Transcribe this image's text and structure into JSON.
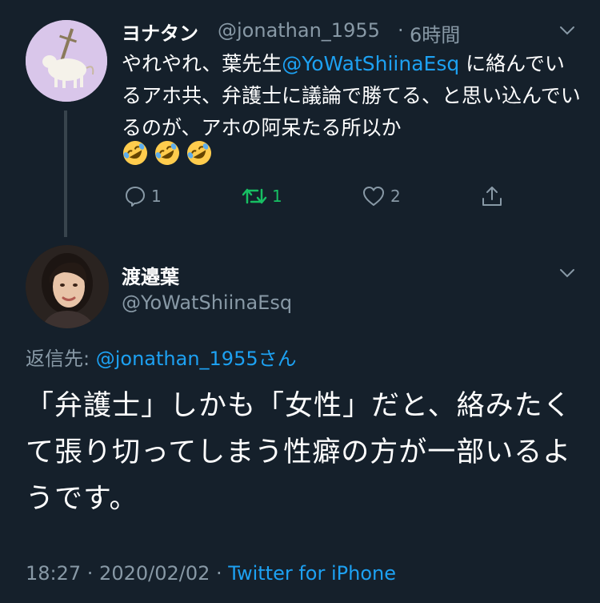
{
  "tweet1": {
    "display_name": "ヨナタン",
    "handle": "@jonathan_1955",
    "separator": "·",
    "time": "6時間",
    "text_prefix": "やれやれ、葉先生",
    "mention": "@YoWatShiinaEsq",
    "text_suffix": " に絡んでいるアホ共、弁護士に議論で勝てる、と思い込んでいるのが、アホの阿呆たる所以か",
    "emojis": [
      "rolling-on-floor-laughing",
      "rolling-on-floor-laughing",
      "rolling-on-floor-laughing"
    ],
    "reply_count": "1",
    "retweet_count": "1",
    "like_count": "2",
    "retweet_color": "#17bf63"
  },
  "tweet2": {
    "display_name": "渡邉葉",
    "handle": "@YoWatShiinaEsq",
    "reply_label": "返信先: ",
    "reply_to": "@jonathan_1955さん",
    "text": "「弁護士」しかも「女性」だと、絡みたくて張り切ってしまう性癖の方が一部いるようです。",
    "timestamp": "18:27 · 2020/02/02 · ",
    "source": "Twitter for iPhone"
  },
  "colors": {
    "background": "#15202b",
    "secondary_text": "#8899a6",
    "accent": "#1da1f2"
  }
}
